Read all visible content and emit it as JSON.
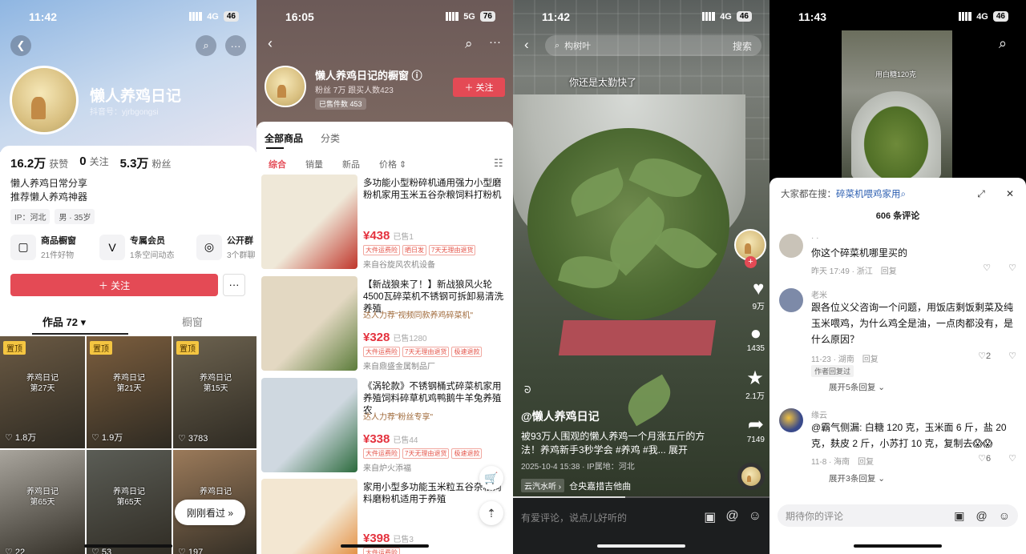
{
  "panel1": {
    "status": {
      "time": "11:42",
      "net": "4G",
      "battery": "46"
    },
    "name": "懒人养鸡日记",
    "sub": "抖音号：yjrbgongsi",
    "stats": [
      {
        "value": "16.2万",
        "label": "获赞"
      },
      {
        "value": "0",
        "label": "关注"
      },
      {
        "value": "5.3万",
        "label": "粉丝"
      }
    ],
    "bio1": "懒人养鸡日常分享",
    "bio2": "推荐懒人养鸡神器",
    "tags": [
      "IP：河北",
      "男 · 35岁"
    ],
    "funcs": [
      {
        "icon": "bag-icon",
        "glyph": "▢",
        "title": "商品橱窗",
        "sub": "21件好物"
      },
      {
        "icon": "vip-icon",
        "glyph": "V",
        "title": "专属会员",
        "sub": "1条空间动态"
      },
      {
        "icon": "group-icon",
        "glyph": "◎",
        "title": "公开群",
        "sub": "3个群聊"
      }
    ],
    "follow": "＋ 关注",
    "more": "···",
    "tabs": {
      "works": "作品 72 ▾",
      "window": "橱窗"
    },
    "videos": [
      {
        "pin": "置顶",
        "title": "养鸡日记\n第27天",
        "views": "♡ 1.8万",
        "bg": "#6b5a44"
      },
      {
        "pin": "置顶",
        "title": "养鸡日记\n第21天",
        "views": "♡ 1.9万",
        "bg": "#7c5e3e"
      },
      {
        "pin": "置顶",
        "title": "养鸡日记\n第15天",
        "views": "♡ 3783",
        "bg": "#6d6350"
      },
      {
        "pin": "",
        "title": "养鸡日记\n第65天",
        "views": "♡ 22",
        "bg": "#a9a59d"
      },
      {
        "pin": "",
        "title": "养鸡日记\n第65天",
        "views": "♡ 53",
        "bg": "#5b5d56"
      },
      {
        "pin": "",
        "title": "养鸡日记",
        "views": "♡ 197",
        "bg": "#9b7a5a"
      }
    ],
    "justnow": "刚刚看过 »"
  },
  "panel2": {
    "status": {
      "time": "16:05",
      "net": "5G",
      "battery": "76"
    },
    "title": "懒人养鸡日记的橱窗 ⓘ",
    "meta": "粉丝 7万   跟买人数423",
    "sold": "已售件数 453",
    "follow": "＋ 关注",
    "tabs": {
      "all": "全部商品",
      "cat": "分类"
    },
    "sort": [
      "综合",
      "销量",
      "新品",
      "价格 ⇕"
    ],
    "products": [
      {
        "name": "多功能小型粉碎机通用强力小型磨粉机家用玉米五谷杂粮饲料打粉机",
        "rec": "",
        "price": "¥438",
        "sold": "已售1",
        "tags": [
          "大件运费险",
          "晒日发",
          "7天无理由退货"
        ],
        "shop": "来自谷旋风农机设备",
        "bg": "#efe8d8",
        "accent": "#c0352a"
      },
      {
        "name": "【新战狼来了！】新战狼风火轮4500瓦碎菜机不锈钢可拆卸易清洗养殖",
        "rec": "达人力荐\"视频同款养鸡碎菜机\"",
        "price": "¥328",
        "sold": "已售1280",
        "tags": [
          "大件运费险",
          "7天无理由退货",
          "极速退款"
        ],
        "shop": "来自鼎盛金属制品厂",
        "bg": "#e3d8c2",
        "accent": "#5b7c3a"
      },
      {
        "name": "《涡轮款》不锈钢桶式碎菜机家用养殖饲料碎草机鸡鸭鹅牛羊兔养殖农",
        "rec": "达人力荐\"粉丝专享\"",
        "price": "¥338",
        "sold": "已售44",
        "tags": [
          "大件运费险",
          "7天无理由退货",
          "极速退款"
        ],
        "shop": "来自炉火添福",
        "bg": "#cfd8e0",
        "accent": "#2b6a3c"
      },
      {
        "name": "家用小型多功能玉米粒五谷杂粮饲料磨粉机适用于养殖",
        "rec": "",
        "price": "¥398",
        "sold": "已售3",
        "tags": [
          "大件运费险"
        ],
        "shop": "",
        "bg": "#f3e7d2",
        "accent": "#e07a1f"
      }
    ]
  },
  "panel3": {
    "status": {
      "time": "11:42",
      "net": "4G",
      "battery": "46"
    },
    "search": "构树叶",
    "search_btn": "搜索",
    "caption": "你还是太勤快了",
    "side": [
      {
        "icon": "heart-icon",
        "glyph": "♥",
        "count": "9万"
      },
      {
        "icon": "comment-icon",
        "glyph": "●",
        "count": "1435"
      },
      {
        "icon": "star-icon",
        "glyph": "★",
        "count": "2.1万"
      },
      {
        "icon": "share-icon",
        "glyph": "➦",
        "count": "7149"
      }
    ],
    "user": "@懒人养鸡日记",
    "desc": "被93万人围观的懒人养鸡一个月涨五斤的方法！养鸡新手3秒学会 #养鸡 #我... 展开",
    "date": "2025-10-4 15:38 · IP属地：河北",
    "music_tag": "云汽水听 ›",
    "music": "仓央嘉措吉他曲",
    "comment_ph": "有爱评论，说点儿好听的"
  },
  "panel4": {
    "status": {
      "time": "11:43",
      "net": "4G",
      "battery": "46"
    },
    "video_cap": "用白糖120克",
    "search_label": "大家都在搜：",
    "search_term": "碎菜机喂鸡家用",
    "count": "606 条评论",
    "comments": [
      {
        "name": "· ·",
        "text": "你这个碎菜机哪里买的",
        "meta": "昨天 17:49 · 浙江",
        "reply": "回复",
        "likes": "",
        "author_tag": "",
        "expand": "",
        "color": "#c9c3b8"
      },
      {
        "name": "老米",
        "text": "跟各位义父咨询一个问题，用饭店剩饭剩菜及纯玉米喂鸡，为什么鸡全是油，一点肉都没有，是什么原因？",
        "meta": "11-23 · 湖南",
        "reply": "回复",
        "likes": "2",
        "author_tag": "作者回复过",
        "expand": "展开5条回复 ⌄",
        "color": "#7d8aa8"
      },
      {
        "name": "缘云",
        "text": "@霸气侧漏: 白糖 120 克，玉米面 6 斤，盐 20 克，麸皮 2 斤，小苏打 10 克，复制去😱😱",
        "meta": "11-8 · 海南",
        "reply": "回复",
        "likes": "6",
        "author_tag": "",
        "expand": "展开3条回复 ⌄",
        "color": "#3a4a8a"
      }
    ],
    "input_ph": "期待你的评论"
  }
}
